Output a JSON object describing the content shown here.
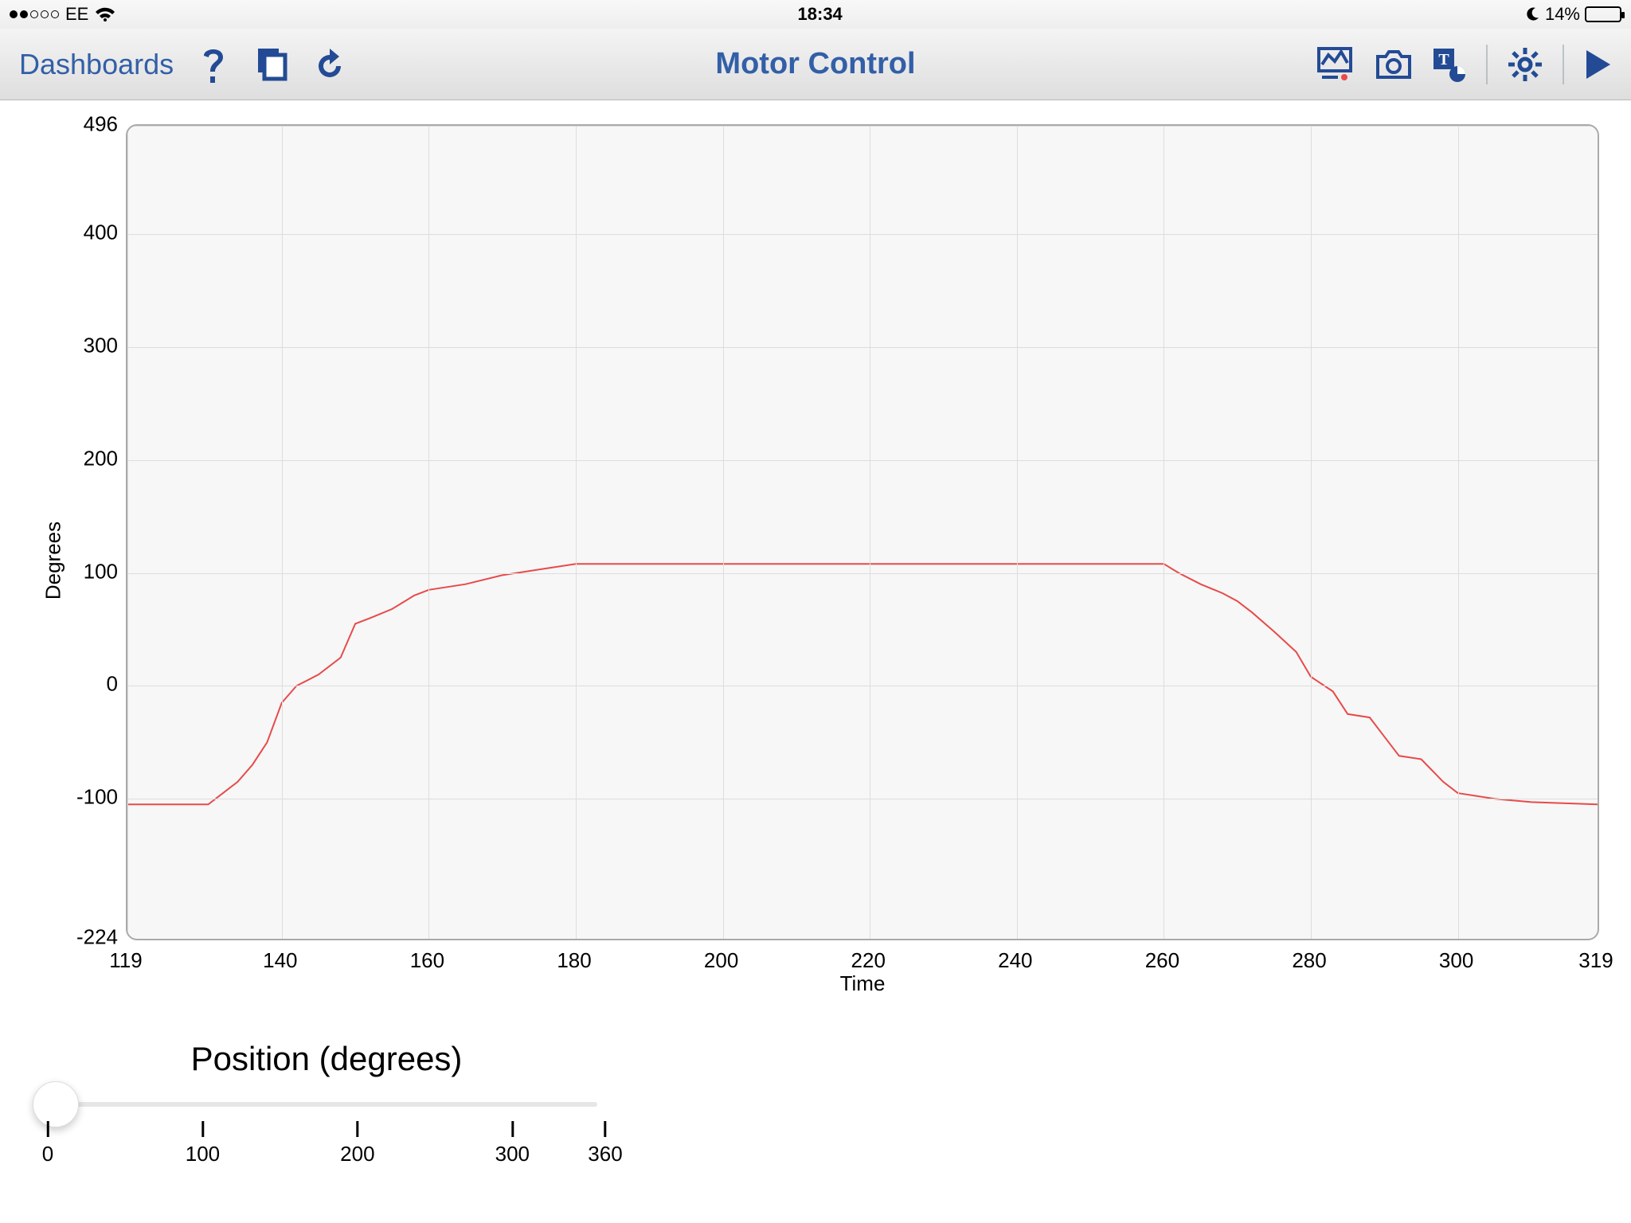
{
  "status": {
    "carrier": "EE",
    "time": "18:34",
    "battery_pct": "14%",
    "signal_filled": 2,
    "signal_total": 5
  },
  "nav": {
    "dashboards_label": "Dashboards",
    "title": "Motor Control"
  },
  "chart": {
    "ylabel": "Degrees",
    "xlabel": "Time",
    "yticks": [
      "496",
      "400",
      "300",
      "200",
      "100",
      "0",
      "-100",
      "-224"
    ],
    "xticks": [
      "119",
      "140",
      "160",
      "180",
      "200",
      "220",
      "240",
      "260",
      "280",
      "300",
      "319"
    ]
  },
  "slider": {
    "title": "Position (degrees)",
    "ticks": [
      "0",
      "100",
      "200",
      "300",
      "360"
    ],
    "value": 0,
    "max": 360
  },
  "chart_data": {
    "type": "line",
    "title": "",
    "xlabel": "Time",
    "ylabel": "Degrees",
    "xlim": [
      119,
      319
    ],
    "ylim": [
      -224,
      496
    ],
    "series": [
      {
        "name": "Degrees",
        "color": "#e84a4a",
        "x": [
          119,
          125,
          130,
          132,
          134,
          136,
          138,
          140,
          142,
          145,
          148,
          150,
          152,
          155,
          158,
          160,
          165,
          170,
          175,
          180,
          190,
          200,
          220,
          240,
          255,
          260,
          262,
          265,
          268,
          270,
          272,
          275,
          278,
          280,
          283,
          285,
          288,
          290,
          292,
          295,
          298,
          300,
          305,
          310,
          319
        ],
        "y": [
          -105,
          -105,
          -105,
          -95,
          -85,
          -70,
          -50,
          -15,
          0,
          10,
          25,
          55,
          60,
          68,
          80,
          85,
          90,
          98,
          103,
          108,
          108,
          108,
          108,
          108,
          108,
          108,
          100,
          90,
          82,
          75,
          65,
          48,
          30,
          8,
          -5,
          -25,
          -28,
          -45,
          -62,
          -65,
          -85,
          -95,
          -100,
          -103,
          -105
        ]
      }
    ]
  }
}
